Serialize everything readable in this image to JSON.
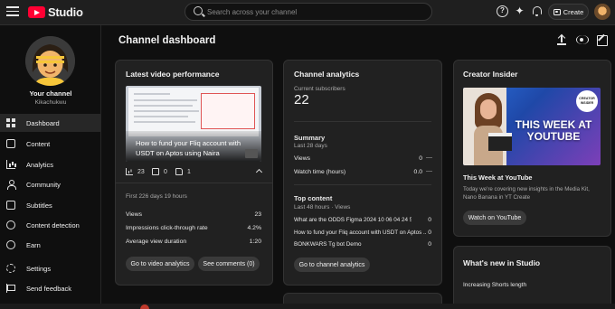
{
  "app": {
    "name": "Studio"
  },
  "search": {
    "placeholder": "Search across your channel"
  },
  "header": {
    "create_label": "Create"
  },
  "sidebar": {
    "channel_label": "Your channel",
    "handle": "Kikachukwu",
    "items": [
      {
        "label": "Dashboard",
        "icon": "dashboard-icon",
        "active": true
      },
      {
        "label": "Content",
        "icon": "content-icon"
      },
      {
        "label": "Analytics",
        "icon": "analytics-icon"
      },
      {
        "label": "Community",
        "icon": "community-icon"
      },
      {
        "label": "Subtitles",
        "icon": "subtitles-icon"
      },
      {
        "label": "Content detection",
        "icon": "content-detection-icon"
      },
      {
        "label": "Earn",
        "icon": "earn-icon"
      },
      {
        "label": "Settings",
        "icon": "gear-icon"
      },
      {
        "label": "Send feedback",
        "icon": "feedback-icon"
      }
    ]
  },
  "page": {
    "title": "Channel dashboard"
  },
  "latest_video": {
    "card_title": "Latest video performance",
    "video_title": "How to fund your Fliq account with USDT on Aptos using Naira",
    "views_count": "23",
    "comments_count": "0",
    "likes_count": "1",
    "period": "First 226 days 19 hours",
    "metrics": [
      {
        "label": "Views",
        "value": "23"
      },
      {
        "label": "Impressions click-through rate",
        "value": "4.2%"
      },
      {
        "label": "Average view duration",
        "value": "1:20"
      }
    ],
    "btn_analytics": "Go to video analytics",
    "btn_comments": "See comments (0)"
  },
  "channel_analytics": {
    "card_title": "Channel analytics",
    "subs_label": "Current subscribers",
    "subs_value": "22",
    "summary_title": "Summary",
    "summary_period": "Last 28 days",
    "summary": [
      {
        "label": "Views",
        "value": "0",
        "trend": "—"
      },
      {
        "label": "Watch time (hours)",
        "value": "0.0",
        "trend": "—"
      }
    ],
    "top_title": "Top content",
    "top_period": "Last 48 hours · Views",
    "top_content": [
      {
        "title": "What are the ODDS Figma 2024 10 06 04 24 53",
        "views": "0"
      },
      {
        "title": "How to fund your Fliq account with USDT on Aptos ...",
        "views": "0"
      },
      {
        "title": "BONKWARS Tg bot Demo",
        "views": "0"
      }
    ],
    "btn": "Go to channel analytics"
  },
  "creator_insider": {
    "card_title": "Creator Insider",
    "thumb_headline": "THIS WEEK AT YOUTUBE",
    "thumb_badge": "CREATOR INSIDER",
    "video_title": "This Week at YouTube",
    "description": "Today we're covering new insights in the Media Kit, Nano Banana in YT Create",
    "btn": "Watch on YouTube"
  },
  "whats_new": {
    "card_title": "What's new in Studio",
    "first_item": "Increasing Shorts length"
  },
  "colors": {
    "brand_red": "#ff0033",
    "bg": "#0f0f0f",
    "card": "#212121"
  }
}
